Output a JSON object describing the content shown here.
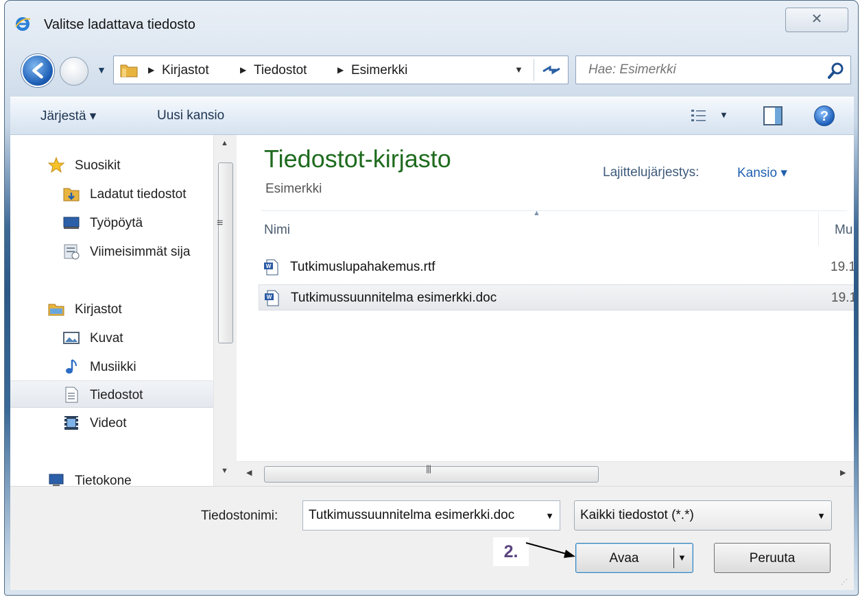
{
  "window": {
    "title": "Valitse ladattava tiedosto",
    "close_glyph": "✕"
  },
  "address": {
    "crumbs": [
      "Kirjastot",
      "Tiedostot",
      "Esimerkki"
    ],
    "search_placeholder": "Hae: Esimerkki"
  },
  "toolbar": {
    "organize_label": "Järjestä ▾",
    "new_folder_label": "Uusi kansio",
    "help_glyph": "?"
  },
  "nav_pane": {
    "items": [
      {
        "label": "Suosikit",
        "icon": "star-icon"
      },
      {
        "label": "Ladatut tiedostot",
        "icon": "downloads-folder-icon"
      },
      {
        "label": "Työpöytä",
        "icon": "desktop-icon"
      },
      {
        "label": "Viimeisimmät sija",
        "icon": "recent-places-icon"
      },
      {
        "label": "Kirjastot",
        "icon": "libraries-icon"
      },
      {
        "label": "Kuvat",
        "icon": "pictures-icon"
      },
      {
        "label": "Musiikki",
        "icon": "music-icon"
      },
      {
        "label": "Tiedostot",
        "icon": "documents-icon",
        "selected": true
      },
      {
        "label": "Videot",
        "icon": "videos-icon"
      },
      {
        "label": "Tietokone",
        "icon": "computer-icon"
      }
    ]
  },
  "file_pane": {
    "library_title": "Tiedostot-kirjasto",
    "library_subtitle": "Esimerkki",
    "sort_label": "Lajittelujärjestys:",
    "sort_value": "Kansio ▾",
    "columns": {
      "name": "Nimi",
      "modified": "Mu"
    },
    "files": [
      {
        "name": "Tutkimuslupahakemus.rtf",
        "date": "19.1",
        "icon": "word-document-icon"
      },
      {
        "name": "Tutkimussuunnitelma esimerkki.doc",
        "date": "19.1",
        "icon": "word-document-icon",
        "selected": true
      }
    ]
  },
  "bottom": {
    "filename_label": "Tiedostonimi:",
    "filename_value": "Tutkimussuunnitelma esimerkki.doc",
    "filetype_value": "Kaikki tiedostot (*.*)",
    "open_label": "Avaa",
    "cancel_label": "Peruuta",
    "step_annotation": "2."
  }
}
